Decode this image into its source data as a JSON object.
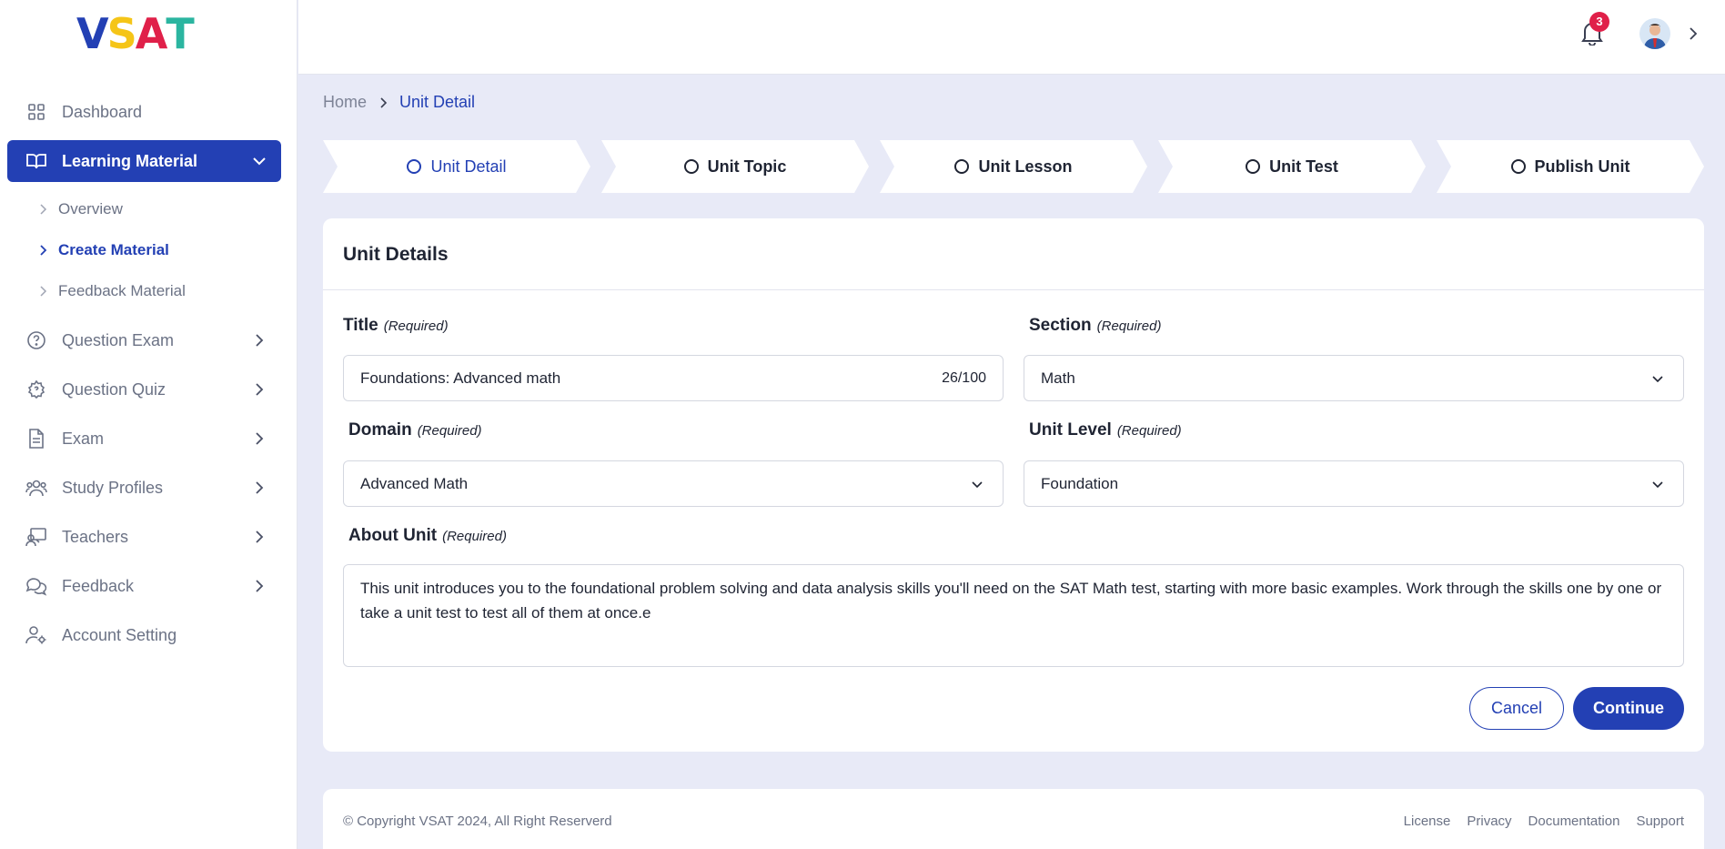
{
  "brand": {
    "logo_letters": [
      "V",
      "S",
      "A",
      "T"
    ],
    "colors": [
      "#2340b4",
      "#f5c518",
      "#e02049",
      "#2bb5a0"
    ]
  },
  "sidebar": {
    "items": [
      {
        "label": "Dashboard",
        "icon": "grid-icon"
      },
      {
        "label": "Learning Material",
        "icon": "book-icon",
        "active": true
      },
      {
        "label": "Question Exam",
        "icon": "help-circle-icon"
      },
      {
        "label": "Question Quiz",
        "icon": "quiz-gear-icon"
      },
      {
        "label": "Exam",
        "icon": "document-icon"
      },
      {
        "label": "Study Profiles",
        "icon": "users-icon"
      },
      {
        "label": "Teachers",
        "icon": "teacher-icon"
      },
      {
        "label": "Feedback",
        "icon": "chat-icon"
      },
      {
        "label": "Account Setting",
        "icon": "user-gear-icon"
      }
    ],
    "sub_items": [
      {
        "label": "Overview"
      },
      {
        "label": "Create Material",
        "current": true
      },
      {
        "label": "Feedback Material"
      }
    ]
  },
  "topbar": {
    "notification_count": "3"
  },
  "breadcrumb": {
    "home": "Home",
    "current": "Unit Detail"
  },
  "steps": [
    {
      "label": "Unit Detail",
      "active": true
    },
    {
      "label": "Unit Topic"
    },
    {
      "label": "Unit Lesson"
    },
    {
      "label": "Unit Test"
    },
    {
      "label": "Publish Unit"
    }
  ],
  "form": {
    "heading": "Unit Details",
    "required_text": "(Required)",
    "title": {
      "label": "Title",
      "value": "Foundations: Advanced math",
      "count": "26/100"
    },
    "section": {
      "label": "Section",
      "value": "Math"
    },
    "domain": {
      "label": "Domain",
      "value": "Advanced Math"
    },
    "unit_level": {
      "label": "Unit Level",
      "value": "Foundation"
    },
    "about": {
      "label": "About Unit",
      "value": "This unit introduces you to the foundational problem solving and data analysis skills you'll need on the SAT Math test, starting with more basic examples. Work through the skills one by one or take a unit test to test all of them at once.e"
    },
    "cancel_label": "Cancel",
    "continue_label": "Continue"
  },
  "footer": {
    "copyright": "© Copyright VSAT 2024, All Right Reserverd",
    "links": [
      "License",
      "Privacy",
      "Documentation",
      "Support"
    ]
  },
  "colors": {
    "accent": "#2340b4",
    "background": "#e8eaf7",
    "badge": "#e02049"
  }
}
